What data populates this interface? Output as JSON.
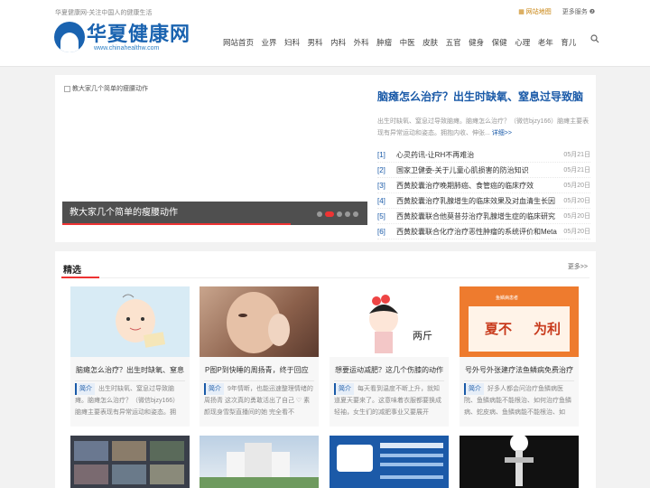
{
  "header": {
    "slogan": "华夏健康网-关注中国人的健康生活",
    "sitemap": "网站地图",
    "more_services": "更多服务",
    "logo_cn": "华夏健康网",
    "logo_en": "www.chinahealthw.com"
  },
  "nav": [
    "网站首页",
    "业界",
    "妇科",
    "男科",
    "内科",
    "外科",
    "肿瘤",
    "中医",
    "皮肤",
    "五官",
    "健身",
    "保健",
    "心理",
    "老年",
    "育儿"
  ],
  "slider": {
    "image_alt": "教大家几个简单的瘦腰动作",
    "caption": "教大家几个简单的瘦腰动作"
  },
  "featured": {
    "title": "脑瘫怎么治疗？出生时缺氧、窒息过导致脑",
    "summary": "出生时缺氧、窒息过导致脑瘫。脑瘫怎么治疗？（微信bjzy166）脑瘫主要表现有异常运动和姿态。拥抱内收、伸张...",
    "more": "详细>>"
  },
  "news": [
    {
      "num": "[1]",
      "title": "心灵药讯-让RH不再难治",
      "date": "05月21日"
    },
    {
      "num": "[2]",
      "title": "国家卫健委-关于儿童心肌损害的防治知识",
      "date": "05月21日"
    },
    {
      "num": "[3]",
      "title": "西黄胶囊治疗晚期肺癌、食管癌的临床疗效",
      "date": "05月20日"
    },
    {
      "num": "[4]",
      "title": "西黄胶囊治疗乳腺增生的临床效果及对血清生长因",
      "date": "05月20日"
    },
    {
      "num": "[5]",
      "title": "西黄胶囊联合他莫昔芬治疗乳腺增生症的临床研究",
      "date": "05月20日"
    },
    {
      "num": "[6]",
      "title": "西黄胶囊联合化疗治疗恶性肿瘤的系统评价和Meta",
      "date": "05月20日"
    }
  ],
  "selection": {
    "heading": "精选",
    "more": "更多>>",
    "tag": "简介",
    "cards": [
      {
        "title": "脑瘫怎么治疗？出生时缺氧、窒息",
        "summary": "出生时缺氧、窒息过导致脑瘫。脑瘫怎么治疗？（微信bjzy166）脑瘫主要表现有异常运动和姿态。拥"
      },
      {
        "title": "P图P到快睡的周扬青，终于回应",
        "summary": "9年情断，也能迅速整理情绪的周扬青 这次真的勇敢活出了自己 ♡ 素颜现身雪梨直播间的她 完全看不"
      },
      {
        "title": "想要运动减肥？这几个伤膝的动作",
        "summary": "每天看到温度不断上升，就知道夏天要来了。这意味着衣服都要换成轻袖，女生们的减肥事业又要展开"
      },
      {
        "title": "号外号外张建疗法鱼鳞病免费治疗",
        "summary": "好多人都会问治疗鱼鳞病医院、鱼鳞病能不能根治、如何治疗鱼鳞病、蛇皮病、鱼鳞病能不能根治、如"
      }
    ],
    "card_image_texts": [
      "两斤",
      "夏不",
      "为利",
      "鱼鳞病患者"
    ]
  },
  "colors": {
    "brand": "#1a63b0",
    "accent": "#e33333",
    "link": "#1a5aa8"
  }
}
